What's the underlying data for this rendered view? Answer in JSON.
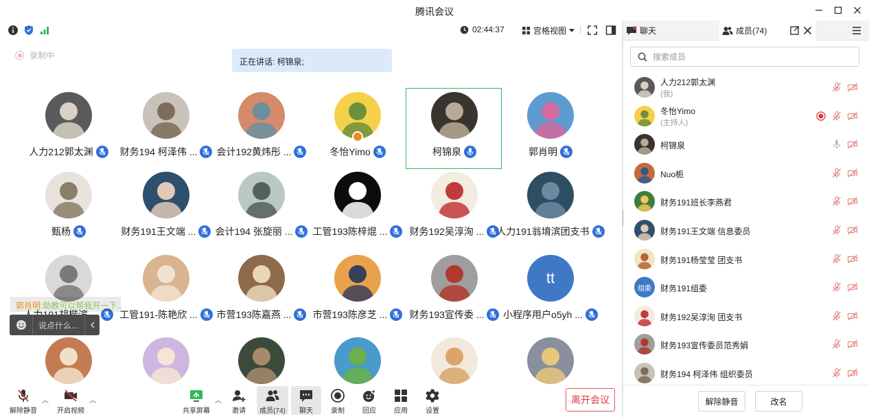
{
  "window": {
    "title": "腾讯会议",
    "controls": {
      "minimize": "—",
      "maximize": "☐",
      "close": "✕"
    }
  },
  "topbar": {
    "timer": "02:44:37",
    "view_label": "宫格视图",
    "icons": [
      "info-icon",
      "shield-icon",
      "signal-icon",
      "clock-icon",
      "grid-view-icon",
      "fullscreen-icon",
      "sidebar-toggle-icon"
    ]
  },
  "recording": {
    "label": "录制中"
  },
  "speaking": {
    "label": "正在讲话: 柯锦泉;"
  },
  "participants": [
    {
      "name": "人力212郭太渊",
      "avatar_color": "#5a5a5a",
      "avatar_color2": "#d8d2c6"
    },
    {
      "name": "财务194 柯泽伟 ...",
      "avatar_color": "#c9c2ba",
      "avatar_color2": "#7c6d5c"
    },
    {
      "name": "会计192黄炜彤 ...",
      "avatar_color": "#d58a6a",
      "avatar_color2": "#6b8f9e"
    },
    {
      "name": "冬怡Yimo",
      "avatar_color": "#f5d14a",
      "avatar_color2": "#6e8f3c",
      "host": true
    },
    {
      "name": "柯锦泉",
      "avatar_color": "#3a342e",
      "avatar_color2": "#b7aa98",
      "speaking": true
    },
    {
      "name": "郭肖明",
      "avatar_color": "#5e9bd1",
      "avatar_color2": "#d46aa0"
    },
    {
      "name": "甄杨",
      "avatar_color": "#e7e3dc",
      "avatar_color2": "#8a7d6a"
    },
    {
      "name": "财务191王文端 ...",
      "avatar_color": "#2f4f6e",
      "avatar_color2": "#e2c8b6"
    },
    {
      "name": "会计194 张旋丽 ...",
      "avatar_color": "#b9c8c1",
      "avatar_color2": "#55625b"
    },
    {
      "name": "工管193陈梓焜 ...",
      "avatar_color": "#0c0c0c",
      "avatar_color2": "#ffffff"
    },
    {
      "name": "财务192吴淳洵 ...",
      "avatar_color": "#f3ece0",
      "avatar_color2": "#c13a3a"
    },
    {
      "name": "人力191翁堉滨团支书",
      "avatar_color": "#2d4e63",
      "avatar_color2": "#6b8aa0"
    },
    {
      "name": "人力191胡楷滨 ...",
      "avatar_color": "#d9d9d9",
      "avatar_color2": "#7a7a7a"
    },
    {
      "name": "工管191-陈艳欣 ...",
      "avatar_color": "#d9b48f",
      "avatar_color2": "#f0e2cf"
    },
    {
      "name": "市营193陈嘉燕 ...",
      "avatar_color": "#8c6a4a",
      "avatar_color2": "#e9d6b8"
    },
    {
      "name": "市营193陈彦芝 ...",
      "avatar_color": "#e9a24b",
      "avatar_color2": "#3a3f5a"
    },
    {
      "name": "财务193宣传委 ...",
      "avatar_color": "#9e9e9e",
      "avatar_color2": "#b03a2e"
    },
    {
      "name": "小程序用户o5yh ...",
      "avatar_color": "#3f79c6",
      "avatar_color2": "#3f79c6",
      "initials": "tt"
    },
    {
      "name": "",
      "avatar_color": "#c47b52",
      "avatar_color2": "#f1e0c8"
    },
    {
      "name": "",
      "avatar_color": "#cdb7e0",
      "avatar_color2": "#f6e4d4"
    },
    {
      "name": "",
      "avatar_color": "#3b4a3b",
      "avatar_color2": "#a68a6a"
    },
    {
      "name": "",
      "avatar_color": "#4a9acb",
      "avatar_color2": "#6ab04c"
    },
    {
      "name": "",
      "avatar_color": "#f2e8dc",
      "avatar_color2": "#d9a56b"
    },
    {
      "name": "",
      "avatar_color": "#8a8f9e",
      "avatar_color2": "#e6c77c"
    }
  ],
  "chat_overlay": {
    "sender": "郭肖明:",
    "message": "助教可以帮我开一下...",
    "placeholder": "说点什么..."
  },
  "toolbar": {
    "unmute": "解除静音",
    "start_video": "开启视频",
    "share_screen": "共享屏幕",
    "invite": "邀请",
    "members": "成员(74)",
    "chat": "聊天",
    "record": "录制",
    "reactions": "回应",
    "apps": "应用",
    "settings": "设置",
    "leave": "离开会议"
  },
  "side_panel": {
    "tab_chat": "聊天",
    "tab_members": "成员(74)",
    "search_placeholder": "搜索成员",
    "members": [
      {
        "name": "人力212郭太渊",
        "role": "(我)",
        "avatar_color": "#5a5a5a",
        "avatar_color2": "#d8d2c6"
      },
      {
        "name": "冬怡Yimo",
        "role": "(主持人)",
        "avatar_color": "#f5d14a",
        "avatar_color2": "#6e8f3c",
        "recording": true
      },
      {
        "name": "柯锦泉",
        "avatar_color": "#3a342e",
        "avatar_color2": "#b7aa98",
        "mic_on": true
      },
      {
        "name": "Nuo栀",
        "avatar_color": "#c56a3c",
        "avatar_color2": "#2e5a8a"
      },
      {
        "name": "财务191班长李燕君",
        "avatar_color": "#3e7d3e",
        "avatar_color2": "#f2c45a"
      },
      {
        "name": "财务191王文端 信息委员",
        "avatar_color": "#2f4f6e",
        "avatar_color2": "#e2c8b6"
      },
      {
        "name": "财务191杨莹莹 团支书",
        "avatar_color": "#f3e3c0",
        "avatar_color2": "#b5643a"
      },
      {
        "name": "财务191组委",
        "avatar_color": "#3f79c6",
        "avatar_color2": "#3f79c6",
        "initials": "组委"
      },
      {
        "name": "财务192吴淳洵 团支书",
        "avatar_color": "#f3ece0",
        "avatar_color2": "#c13a3a"
      },
      {
        "name": "财务193宣传委员范秀娟",
        "avatar_color": "#9e9e9e",
        "avatar_color2": "#b03a2e"
      },
      {
        "name": "财务194 柯泽伟 组织委员",
        "avatar_color": "#c9c2ba",
        "avatar_color2": "#7c6d5c"
      }
    ],
    "footer": {
      "unmute_all": "解除静音",
      "rename": "改名"
    }
  },
  "colors": {
    "accent": "#2f6fdd",
    "danger": "#e03a3a",
    "muted_red": "#e88a8a",
    "speaking_border": "#2eb85c"
  }
}
